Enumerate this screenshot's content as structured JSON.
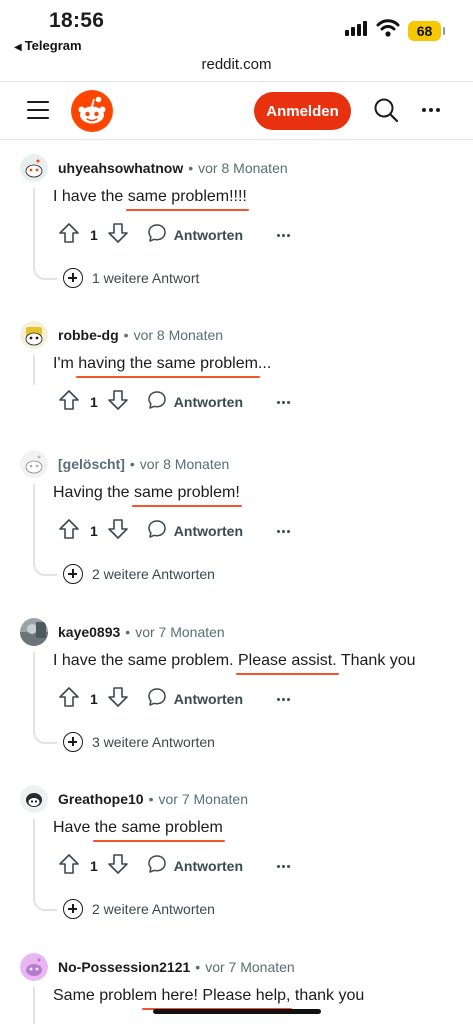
{
  "status_bar": {
    "time": "18:56",
    "back_app": "Telegram",
    "battery": "68"
  },
  "browser": {
    "url": "reddit.com"
  },
  "header": {
    "login_label": "Anmelden"
  },
  "comments": [
    {
      "user": "uhyeahsowhatnow",
      "time": "vor 8 Monaten",
      "text_pre": "I have the ",
      "text_hl": "same problem!!!!",
      "text_post": "",
      "votes": "1",
      "reply_label": "Antworten",
      "more_replies": "1 weitere Antwort",
      "avatar": "snoo-white"
    },
    {
      "user": "robbe-dg",
      "time": "vor 8 Monaten",
      "text_pre": "I'm ",
      "text_hl": "having the same problem",
      "text_post": "...",
      "votes": "1",
      "reply_label": "Antworten",
      "more_replies": "",
      "avatar": "snoo-yellow"
    },
    {
      "user": "[gelöscht]",
      "time": "vor 8 Monaten",
      "text_pre": "Having the ",
      "text_hl": "same problem!",
      "text_post": "",
      "votes": "1",
      "reply_label": "Antworten",
      "more_replies": "2 weitere Antworten",
      "avatar": "snoo-grey"
    },
    {
      "user": "kaye0893",
      "time": "vor 7 Monaten",
      "text_pre": "I have the same problem. ",
      "text_hl": "Please assist.",
      "text_post": " Thank you",
      "votes": "1",
      "reply_label": "Antworten",
      "more_replies": "3 weitere Antworten",
      "avatar": "photo"
    },
    {
      "user": "Greathope10",
      "time": "vor 7 Monaten",
      "text_pre": "Have ",
      "text_hl": "the same problem",
      "text_post": "",
      "votes": "1",
      "reply_label": "Antworten",
      "more_replies": "2 weitere Antworten",
      "avatar": "snoo-dark"
    },
    {
      "user": "No-Possession2121",
      "time": "vor 7 Monaten",
      "text_pre": "Same proble",
      "text_hl": "m here! Please help,",
      "text_post": " thank you",
      "avatar": "snoo-purple"
    }
  ],
  "colors": {
    "accent": "#e8320f",
    "highlight": "#f0552b",
    "meta": "#576f76"
  }
}
